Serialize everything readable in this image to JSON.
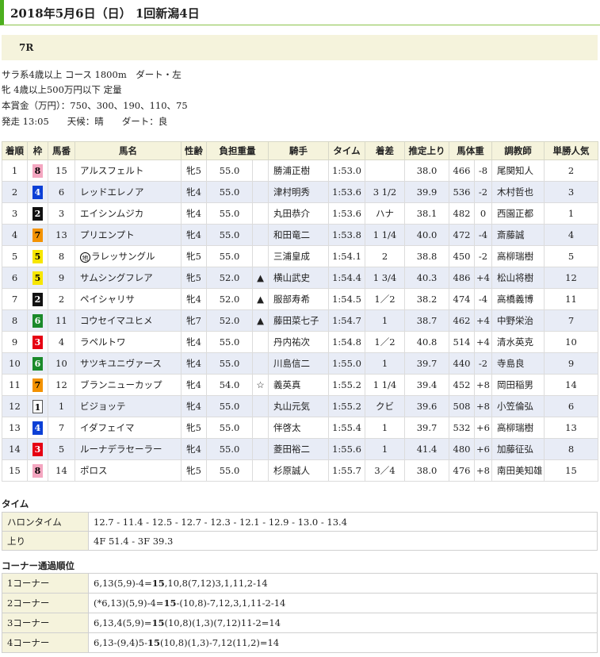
{
  "header": {
    "title": "2018年5月6日（日） 1回新潟4日"
  },
  "race": {
    "number": "7R"
  },
  "conditions": [
    "サラ系4歳以上 コース 1800m　ダート・左",
    "牝 4歳以上500万円以下 定量",
    "本賞金（万円）：750、300、190、110、75",
    "発走 13:05　　天候：晴　　ダート：良"
  ],
  "table": {
    "headers": [
      "着順",
      "枠",
      "馬番",
      "馬名",
      "性齢",
      "負担重量",
      "",
      "騎手",
      "タイム",
      "着差",
      "推定上り",
      "馬体重",
      "",
      "調教師",
      "単勝人気"
    ],
    "rows": [
      {
        "pos": "1",
        "gate": "8",
        "num": "15",
        "horse": "アルスフェルト",
        "local": "",
        "sexage": "牝5",
        "weight": "55.0",
        "mark": "",
        "jockey": "勝浦正樹",
        "time": "1:53.0",
        "margin": "",
        "last3f": "38.0",
        "bw": "466",
        "bwd": "-8",
        "trainer": "尾関知人",
        "pop": "2"
      },
      {
        "pos": "2",
        "gate": "4",
        "num": "6",
        "horse": "レッドエレノア",
        "local": "",
        "sexage": "牝4",
        "weight": "55.0",
        "mark": "",
        "jockey": "津村明秀",
        "time": "1:53.6",
        "margin": "3 1/2",
        "last3f": "39.9",
        "bw": "536",
        "bwd": "-2",
        "trainer": "木村哲也",
        "pop": "3"
      },
      {
        "pos": "3",
        "gate": "2",
        "num": "3",
        "horse": "エイシンムジカ",
        "local": "",
        "sexage": "牝4",
        "weight": "55.0",
        "mark": "",
        "jockey": "丸田恭介",
        "time": "1:53.6",
        "margin": "ハナ",
        "last3f": "38.1",
        "bw": "482",
        "bwd": "0",
        "trainer": "西園正都",
        "pop": "1"
      },
      {
        "pos": "4",
        "gate": "7",
        "num": "13",
        "horse": "プリエンプト",
        "local": "",
        "sexage": "牝4",
        "weight": "55.0",
        "mark": "",
        "jockey": "和田竜二",
        "time": "1:53.8",
        "margin": "1 1/4",
        "last3f": "40.0",
        "bw": "472",
        "bwd": "-4",
        "trainer": "斎藤誠",
        "pop": "4"
      },
      {
        "pos": "5",
        "gate": "5",
        "num": "8",
        "horse": "ラレッサングル",
        "local": "地",
        "sexage": "牝5",
        "weight": "55.0",
        "mark": "",
        "jockey": "三浦皇成",
        "time": "1:54.1",
        "margin": "2",
        "last3f": "38.8",
        "bw": "450",
        "bwd": "-2",
        "trainer": "高柳瑞樹",
        "pop": "5"
      },
      {
        "pos": "6",
        "gate": "5",
        "num": "9",
        "horse": "サムシングフレア",
        "local": "",
        "sexage": "牝5",
        "weight": "52.0",
        "mark": "▲",
        "jockey": "横山武史",
        "time": "1:54.4",
        "margin": "1 3/4",
        "last3f": "40.3",
        "bw": "486",
        "bwd": "+4",
        "trainer": "松山将樹",
        "pop": "12"
      },
      {
        "pos": "7",
        "gate": "2",
        "num": "2",
        "horse": "ペイシャリサ",
        "local": "",
        "sexage": "牝4",
        "weight": "52.0",
        "mark": "▲",
        "jockey": "服部寿希",
        "time": "1:54.5",
        "margin": "1／2",
        "last3f": "38.2",
        "bw": "474",
        "bwd": "-4",
        "trainer": "高橋義博",
        "pop": "11"
      },
      {
        "pos": "8",
        "gate": "6",
        "num": "11",
        "horse": "コウセイマユヒメ",
        "local": "",
        "sexage": "牝7",
        "weight": "52.0",
        "mark": "▲",
        "jockey": "藤田菜七子",
        "time": "1:54.7",
        "margin": "1",
        "last3f": "38.7",
        "bw": "462",
        "bwd": "+4",
        "trainer": "中野栄治",
        "pop": "7"
      },
      {
        "pos": "9",
        "gate": "3",
        "num": "4",
        "horse": "ラペルトワ",
        "local": "",
        "sexage": "牝4",
        "weight": "55.0",
        "mark": "",
        "jockey": "丹内祐次",
        "time": "1:54.8",
        "margin": "1／2",
        "last3f": "40.8",
        "bw": "514",
        "bwd": "+4",
        "trainer": "清水英克",
        "pop": "10"
      },
      {
        "pos": "10",
        "gate": "6",
        "num": "10",
        "horse": "サツキユニヴァース",
        "local": "",
        "sexage": "牝4",
        "weight": "55.0",
        "mark": "",
        "jockey": "川島信二",
        "time": "1:55.0",
        "margin": "1",
        "last3f": "39.7",
        "bw": "440",
        "bwd": "-2",
        "trainer": "寺島良",
        "pop": "9"
      },
      {
        "pos": "11",
        "gate": "7",
        "num": "12",
        "horse": "ブランニューカップ",
        "local": "",
        "sexage": "牝4",
        "weight": "54.0",
        "mark": "☆",
        "jockey": "義英真",
        "time": "1:55.2",
        "margin": "1 1/4",
        "last3f": "39.4",
        "bw": "452",
        "bwd": "+8",
        "trainer": "岡田稲男",
        "pop": "14"
      },
      {
        "pos": "12",
        "gate": "1",
        "num": "1",
        "horse": "ビジョッテ",
        "local": "",
        "sexage": "牝4",
        "weight": "55.0",
        "mark": "",
        "jockey": "丸山元気",
        "time": "1:55.2",
        "margin": "クビ",
        "last3f": "39.6",
        "bw": "508",
        "bwd": "+8",
        "trainer": "小笠倫弘",
        "pop": "6"
      },
      {
        "pos": "13",
        "gate": "4",
        "num": "7",
        "horse": "イダフェイマ",
        "local": "",
        "sexage": "牝5",
        "weight": "55.0",
        "mark": "",
        "jockey": "伴啓太",
        "time": "1:55.4",
        "margin": "1",
        "last3f": "39.7",
        "bw": "532",
        "bwd": "+6",
        "trainer": "高柳瑞樹",
        "pop": "13"
      },
      {
        "pos": "14",
        "gate": "3",
        "num": "5",
        "horse": "ルーナデラセーラー",
        "local": "",
        "sexage": "牝4",
        "weight": "55.0",
        "mark": "",
        "jockey": "菱田裕二",
        "time": "1:55.6",
        "margin": "1",
        "last3f": "41.4",
        "bw": "480",
        "bwd": "+6",
        "trainer": "加藤征弘",
        "pop": "8"
      },
      {
        "pos": "15",
        "gate": "8",
        "num": "14",
        "horse": "ポロス",
        "local": "",
        "sexage": "牝5",
        "weight": "55.0",
        "mark": "",
        "jockey": "杉原誠人",
        "time": "1:55.7",
        "margin": "3／4",
        "last3f": "38.0",
        "bw": "476",
        "bwd": "+8",
        "trainer": "南田美知雄",
        "pop": "15"
      }
    ]
  },
  "times": {
    "section_label": "タイム",
    "furlong_label": "ハロンタイム",
    "furlong_value": "12.7 - 11.4 - 12.5 - 12.7 - 12.3 - 12.1 - 12.9 - 13.0 - 13.4",
    "agari_label": "上り",
    "agari_value": "4F 51.4 - 3F 39.3"
  },
  "corners": {
    "section_label": "コーナー通過順位",
    "rows": [
      {
        "label": "1コーナー",
        "pre": "6,13(5,9)-4=",
        "bold": "15",
        "post": ",10,8(7,12)3,1,11,2-14"
      },
      {
        "label": "2コーナー",
        "pre": "(*6,13)(5,9)-4=",
        "bold": "15",
        "post": "-(10,8)-7,12,3,1,11-2-14"
      },
      {
        "label": "3コーナー",
        "pre": "6,13,4(5,9)=",
        "bold": "15",
        "post": "(10,8)(1,3)(7,12)11-2=14"
      },
      {
        "label": "4コーナー",
        "pre": "6,13-(9,4)5-",
        "bold": "15",
        "post": "(10,8)(1,3)-7,12(11,2)=14"
      }
    ]
  },
  "colors": {
    "accent": "#4caf1e",
    "header_bg": "#f5f3dc",
    "row_alt": "#e8ecf6"
  }
}
